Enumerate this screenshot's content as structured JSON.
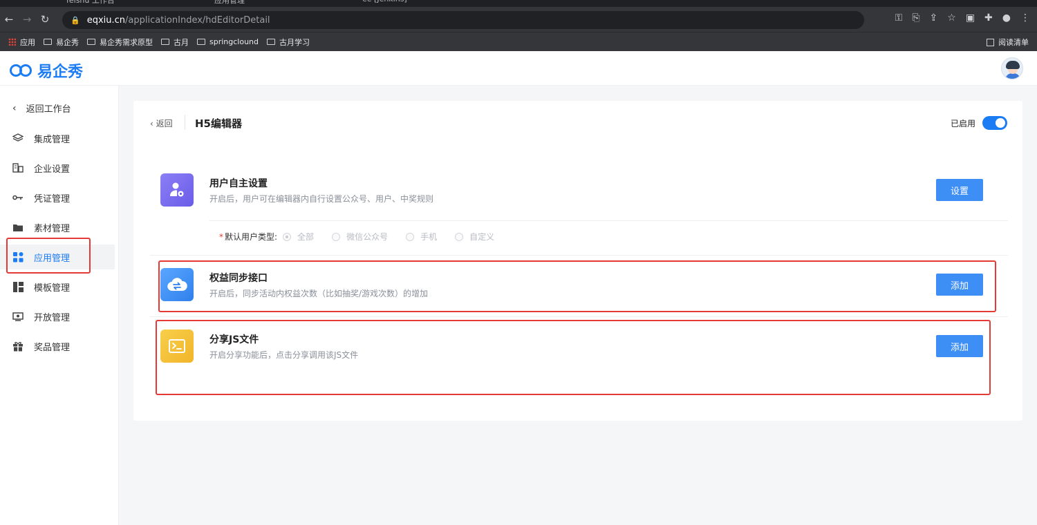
{
  "browser": {
    "tabs": [
      "feishu 工作台",
      "应用管理",
      "ee [Jenkins]"
    ],
    "url_host": "eqxiu.cn",
    "url_path": "/applicationIndex/hdEditorDetail",
    "bookmarks": [
      "应用",
      "易企秀",
      "易企秀需求原型",
      "古月",
      "springclound",
      "古月学习"
    ],
    "reading_list": "阅读清单"
  },
  "header": {
    "logo_text": "易企秀",
    "brand_color": "#1c7cf4"
  },
  "sidebar": {
    "back_label": "返回工作台",
    "items": [
      {
        "label": "集成管理",
        "icon": "layers-icon"
      },
      {
        "label": "企业设置",
        "icon": "building-icon"
      },
      {
        "label": "凭证管理",
        "icon": "key-icon"
      },
      {
        "label": "素材管理",
        "icon": "folder-icon"
      },
      {
        "label": "应用管理",
        "icon": "apps-icon",
        "active": true
      },
      {
        "label": "模板管理",
        "icon": "template-icon"
      },
      {
        "label": "开放管理",
        "icon": "open-icon"
      },
      {
        "label": "奖品管理",
        "icon": "gift-icon"
      }
    ]
  },
  "main": {
    "back_label": "返回",
    "title": "H5编辑器",
    "status_label": "已启用",
    "features": [
      {
        "title": "用户自主设置",
        "desc": "开启后，用户可在编辑器内自行设置公众号、用户、中奖规则",
        "button": "设置",
        "icon": "user-settings-icon",
        "color": "#7a6cf0"
      },
      {
        "title": "权益同步接口",
        "desc": "开启后，同步活动内权益次数（比如抽奖/游戏次数）的增加",
        "button": "添加",
        "icon": "cloud-sync-icon",
        "color": "#3d8ef5"
      },
      {
        "title": "分享JS文件",
        "desc": "开启分享功能后，点击分享调用该JS文件",
        "button": "添加",
        "icon": "terminal-icon",
        "color": "#f5c23a"
      }
    ],
    "user_type": {
      "label": "默认用户类型:",
      "required_mark": "*",
      "options": [
        "全部",
        "微信公众号",
        "手机",
        "自定义"
      ],
      "selected": "全部"
    }
  }
}
